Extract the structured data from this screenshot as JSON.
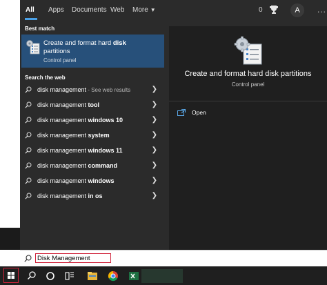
{
  "tabs": [
    {
      "label": "All"
    },
    {
      "label": "Apps"
    },
    {
      "label": "Documents"
    },
    {
      "label": "Web"
    },
    {
      "label": "More"
    }
  ],
  "header": {
    "points": "0",
    "avatar_letter": "A",
    "menu": "..."
  },
  "best_match": {
    "heading": "Best match",
    "title_prefix": "Create and format hard ",
    "title_bold": "disk",
    "title_rest": " partitions",
    "subtitle": "Control panel"
  },
  "web": {
    "heading": "Search the web",
    "rows": [
      {
        "base": "disk management",
        "bold": "",
        "suffix": " - See web results"
      },
      {
        "base": "disk management ",
        "bold": "tool",
        "suffix": ""
      },
      {
        "base": "disk management ",
        "bold": "windows 10",
        "suffix": ""
      },
      {
        "base": "disk management ",
        "bold": "system",
        "suffix": ""
      },
      {
        "base": "disk management ",
        "bold": "windows 11",
        "suffix": ""
      },
      {
        "base": "disk management ",
        "bold": "command",
        "suffix": ""
      },
      {
        "base": "disk management ",
        "bold": "windows",
        "suffix": ""
      },
      {
        "base": "disk management ",
        "bold": "in os",
        "suffix": ""
      }
    ]
  },
  "preview": {
    "title": "Create and format hard disk partitions",
    "subtitle": "Control panel",
    "open_label": "Open"
  },
  "search": {
    "value": "Disk Management"
  },
  "colors": {
    "accent": "#4aa0e6",
    "selected_card": "#27507a",
    "highlight_border": "#d0223a"
  },
  "icons": {
    "start": "windows-start-icon",
    "search": "search-icon",
    "cortana": "cortana-circle-icon",
    "task_view": "task-view-icon",
    "explorer": "file-explorer-icon",
    "chrome": "chrome-icon",
    "excel": "excel-icon"
  }
}
